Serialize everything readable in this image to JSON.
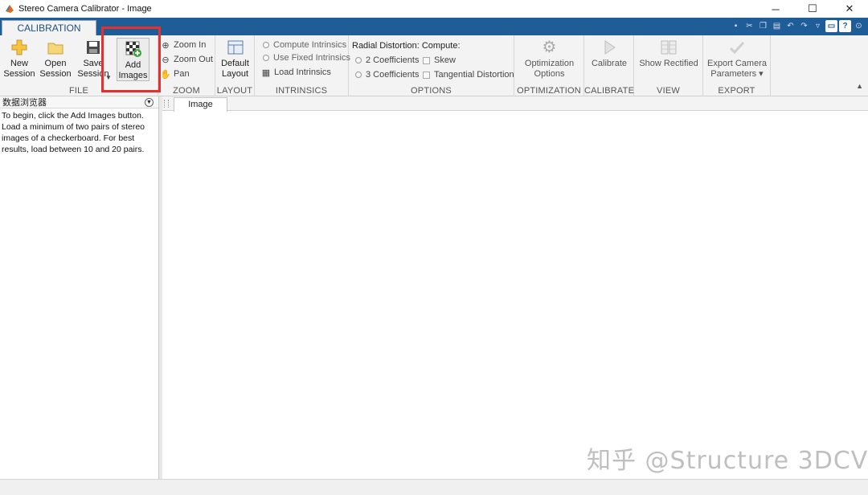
{
  "window": {
    "title": "Stereo Camera Calibrator - Image",
    "minimize": "─",
    "maximize": "☐",
    "close": "✕"
  },
  "ribbon": {
    "tab_label": "CALIBRATION",
    "file": {
      "label": "FILE",
      "new_session": "New\nSession",
      "open_session": "Open\nSession",
      "save_session": "Save\nSession",
      "add_images": "Add\nImages"
    },
    "zoom": {
      "label": "ZOOM",
      "zoom_in": "Zoom In",
      "zoom_out": "Zoom Out",
      "pan": "Pan"
    },
    "layout": {
      "label": "LAYOUT",
      "default_layout": "Default\nLayout"
    },
    "intrinsics": {
      "label": "INTRINSICS",
      "compute": "Compute Intrinsics",
      "use_fixed": "Use Fixed Intrinsics",
      "load": "Load Intrinsics"
    },
    "options": {
      "label": "OPTIONS",
      "radial_heading": "Radial Distortion:",
      "compute_heading": "Compute:",
      "two_coeff": "2 Coefficients",
      "three_coeff": "3 Coefficients",
      "skew": "Skew",
      "tangential": "Tangential Distortion"
    },
    "optimization": {
      "label": "OPTIMIZATION",
      "options_btn": "Optimization\nOptions"
    },
    "calibrate": {
      "label": "CALIBRATE",
      "calibrate_btn": "Calibrate"
    },
    "view": {
      "label": "VIEW",
      "show_rectified": "Show Rectified"
    },
    "export": {
      "label": "EXPORT",
      "export_btn": "Export Camera\nParameters ▾"
    }
  },
  "data_browser": {
    "title": "数据浏览器",
    "instructions": "To begin, click the Add Images button. Load a minimum of two pairs of stereo images of a checkerboard. For best results, load between 10 and 20 pairs."
  },
  "document": {
    "tab_label": "Image"
  },
  "watermark": "知乎 @Structure 3DCV",
  "colors": {
    "tabstrip": "#1f5d99",
    "highlight": "#e6302e",
    "ribbon_bg": "#f3f3f3"
  }
}
